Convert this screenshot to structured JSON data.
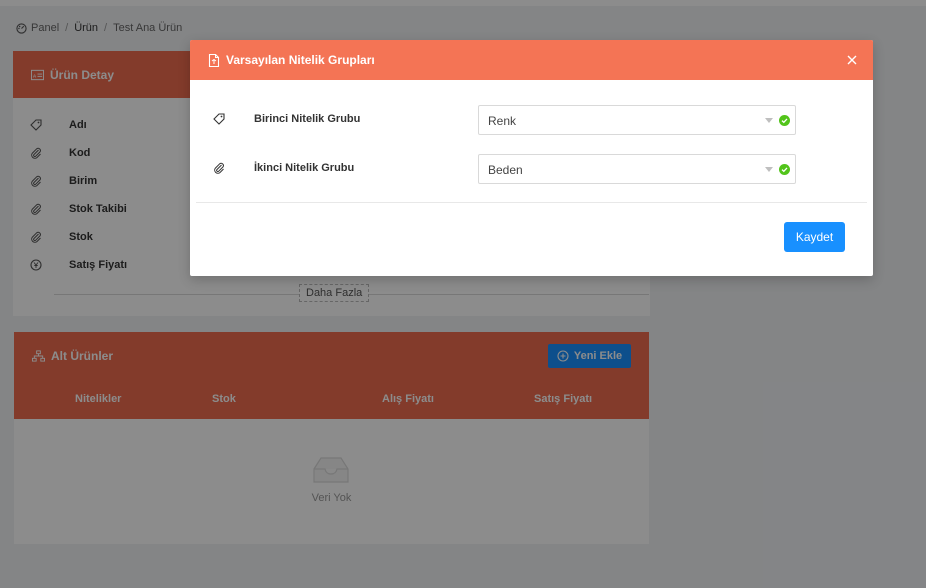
{
  "breadcrumb": [
    "Panel",
    "Ürün",
    "Test Ana Ürün"
  ],
  "detail": {
    "title": "Ürün Detay",
    "fields": [
      "Adı",
      "Kod",
      "Birim",
      "Stok Takibi",
      "Stok",
      "Satış Fiyatı"
    ],
    "more_label": "Daha Fazla"
  },
  "sub_products": {
    "title": "Alt Ürünler",
    "add_label": "Yeni Ekle",
    "columns": [
      "Nitelikler",
      "Stok",
      "Alış Fiyatı",
      "Satış Fiyatı"
    ],
    "empty_text": "Veri Yok"
  },
  "modal": {
    "title": "Varsayılan Nitelik Grupları",
    "fields": [
      {
        "label": "Birinci Nitelik Grubu",
        "value": "Renk"
      },
      {
        "label": "İkinci Nitelik Grubu",
        "value": "Beden"
      }
    ],
    "save_label": "Kaydet"
  },
  "colors": {
    "header_orange": "#ef6c4f",
    "modal_header": "#f47455",
    "primary_blue": "#1890ff",
    "success_green": "#52c41a"
  },
  "icons": {
    "breadcrumb": "dashboard-icon",
    "detail_header": "id-card-icon",
    "sub_header": "hierarchy-icon",
    "add": "plus-circle-icon",
    "empty": "inbox-icon",
    "modal_header": "file-icon",
    "close": "close-icon"
  }
}
